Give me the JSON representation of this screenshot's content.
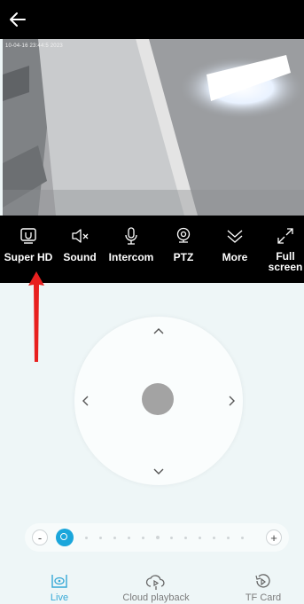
{
  "feed": {
    "timestamp": "10-04-16 23:44:5 2023"
  },
  "controls": [
    {
      "label": "Super HD",
      "icon": "hd-icon"
    },
    {
      "label": "Sound",
      "icon": "speaker-muted-icon"
    },
    {
      "label": "Intercom",
      "icon": "microphone-icon"
    },
    {
      "label": "PTZ",
      "icon": "ptz-camera-icon"
    },
    {
      "label": "More",
      "icon": "chevron-down-double-icon"
    },
    {
      "label": "Full screen",
      "icon": "fullscreen-icon"
    }
  ],
  "slider": {
    "minus": "-",
    "plus": "+",
    "zoom_level_fraction": 0.0
  },
  "nav": [
    {
      "label": "Live",
      "active": true,
      "icon": "live-camera-icon"
    },
    {
      "label": "Cloud playback",
      "active": false,
      "icon": "cloud-playback-icon"
    },
    {
      "label": "TF Card",
      "active": false,
      "icon": "tf-card-icon"
    }
  ],
  "colors": {
    "accent": "#35a8d6",
    "thumb": "#1aa6db",
    "annotation_arrow": "#e8201f"
  }
}
